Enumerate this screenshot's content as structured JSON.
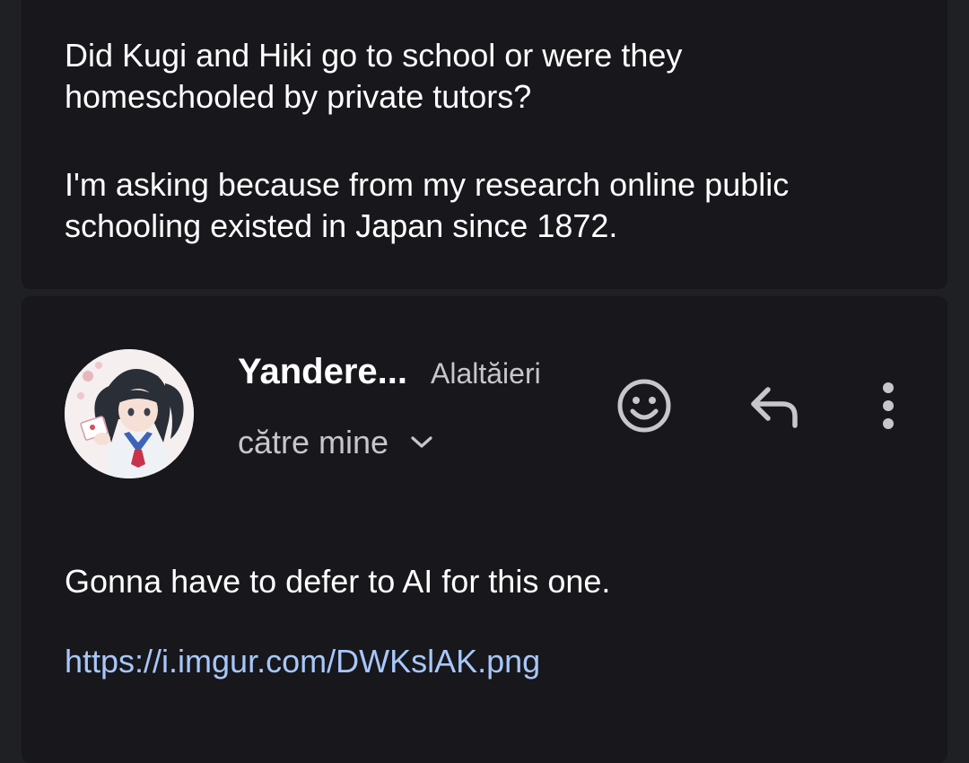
{
  "previous_message": {
    "paragraphs": [
      "Did Kugi and Hiki go to school or were they\nhomeschooled by private tutors?",
      "I'm asking because from my research online public\nschooling existed in Japan since 1872."
    ]
  },
  "message": {
    "sender_name": "Yandere...",
    "date": "Alaltăieri",
    "recipient_label": "către mine",
    "body": "Gonna have to defer to AI for this one.",
    "link": "https://i.imgur.com/DWKslAK.png"
  },
  "icons": {
    "emoji": "add-reaction-icon",
    "reply": "reply-icon",
    "more": "more-vert-icon",
    "expand": "chevron-down-icon"
  },
  "colors": {
    "background": "#1f2024",
    "card": "#17171c",
    "text": "#ffffff",
    "secondary_text": "#c6c6cb",
    "link": "#a8c7fa"
  }
}
